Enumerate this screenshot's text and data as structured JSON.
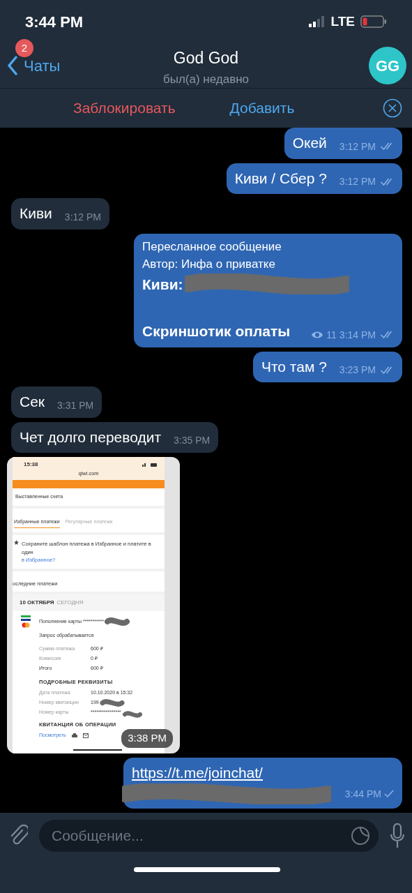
{
  "status_bar": {
    "time": "3:44 PM",
    "network": "LTE"
  },
  "header": {
    "back_label": "Чаты",
    "unread_badge": "2",
    "title": "God God",
    "subtitle": "был(а) недавно",
    "avatar_initials": "GG"
  },
  "action_bar": {
    "block": "Заблокировать",
    "add": "Добавить"
  },
  "messages": [
    {
      "kind": "text",
      "outgoing": true,
      "text": "Окей",
      "time": "3:12 PM",
      "read": true
    },
    {
      "kind": "text",
      "outgoing": true,
      "text": "Киви / Сбер ?",
      "time": "3:12 PM",
      "read": true
    },
    {
      "kind": "text",
      "outgoing": false,
      "text": "Киви",
      "time": "3:12 PM"
    },
    {
      "kind": "forwarded",
      "outgoing": true,
      "header": "Пересланное сообщение",
      "author": "Автор: Инфа о приватке",
      "lines": [
        "Киви:",
        "Скриншотик оплаты"
      ],
      "views": "11",
      "time": "3:14 PM",
      "read": true
    },
    {
      "kind": "text",
      "outgoing": true,
      "text": "Что там ?",
      "time": "3:23 PM",
      "read": true
    },
    {
      "kind": "text",
      "outgoing": false,
      "text": "Сек",
      "time": "3:31 PM"
    },
    {
      "kind": "text",
      "outgoing": false,
      "text": "Чет долго переводит",
      "time": "3:35 PM"
    },
    {
      "kind": "screenshot",
      "outgoing": false,
      "time": "3:38 PM",
      "screenshot": {
        "clock": "15:38",
        "domain": "qiwi.com",
        "bills": "Выставленные счета",
        "tabs": [
          {
            "label": "Избранные платежи",
            "selected": true
          },
          {
            "label": "Регулярные платежи",
            "selected": false
          }
        ],
        "tip": "Сохраните шаблон платежа в Избранное и платите в один",
        "tip_link": "в Избранное?",
        "section": "оследние платежи",
        "date": "10 ОКТЯБРЯ",
        "date_note": "СЕГОДНЯ",
        "payment": "Пополнение карты ***********",
        "status": "Запрос обрабатывается",
        "amounts": [
          [
            "Сумма платежа",
            "600 ₽"
          ],
          [
            "Комиссия",
            "0 ₽"
          ],
          [
            "Итого",
            "600 ₽"
          ]
        ],
        "details_title": "ПОДРОБНЫЕ РЕКВИЗИТЫ",
        "details": [
          [
            "Дата платежа",
            "10.10.2020 в 15:32"
          ],
          [
            "Номер квитанции",
            "199"
          ],
          [
            "Номер карты",
            "****************"
          ]
        ],
        "receipt_title": "КВИТАНЦИЯ ОБ ОПЕРАЦИИ",
        "receipt_link": "Посмотреть"
      }
    },
    {
      "kind": "link",
      "outgoing": true,
      "url": "https://t.me/joinchat/",
      "time": "3:44 PM",
      "read": false
    }
  ],
  "composer": {
    "placeholder": "Сообщение..."
  }
}
